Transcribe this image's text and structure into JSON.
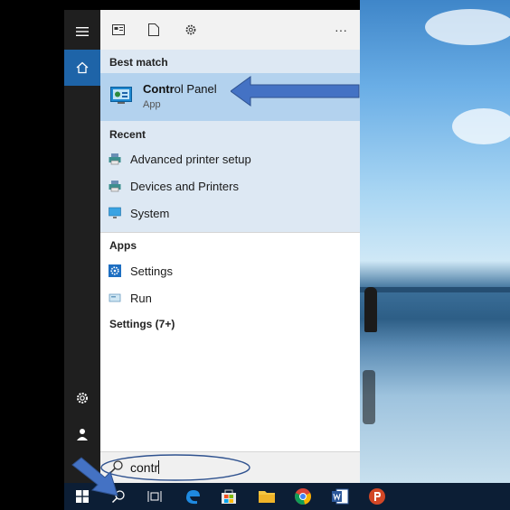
{
  "search": {
    "query": "contr",
    "best_match_heading": "Best match",
    "best_match": {
      "title_bold": "Contr",
      "title_rest": "ol Panel",
      "subtitle": "App"
    },
    "recent_heading": "Recent",
    "recent": [
      {
        "label": "Advanced printer setup",
        "icon": "printer-icon"
      },
      {
        "label": "Devices and Printers",
        "icon": "printer-icon"
      },
      {
        "label": "System",
        "icon": "system-monitor-icon"
      }
    ],
    "apps_heading": "Apps",
    "apps": [
      {
        "label": "Settings",
        "icon": "settings-gear-icon"
      },
      {
        "label": "Run",
        "icon": "run-icon"
      }
    ],
    "settings_heading": "Settings (7+)",
    "more_label": "···"
  },
  "colors": {
    "accent": "#1e64a8",
    "best_match_bg": "#b3d2ee",
    "results_bg": "#dde8f3",
    "taskbar": "#0c1e35",
    "annotation_arrow": "#4472c4"
  },
  "taskbar_icons": [
    "start-icon",
    "search-icon",
    "task-view-icon",
    "edge-icon",
    "store-icon",
    "file-explorer-icon",
    "chrome-icon",
    "word-icon",
    "powerpoint-icon"
  ]
}
